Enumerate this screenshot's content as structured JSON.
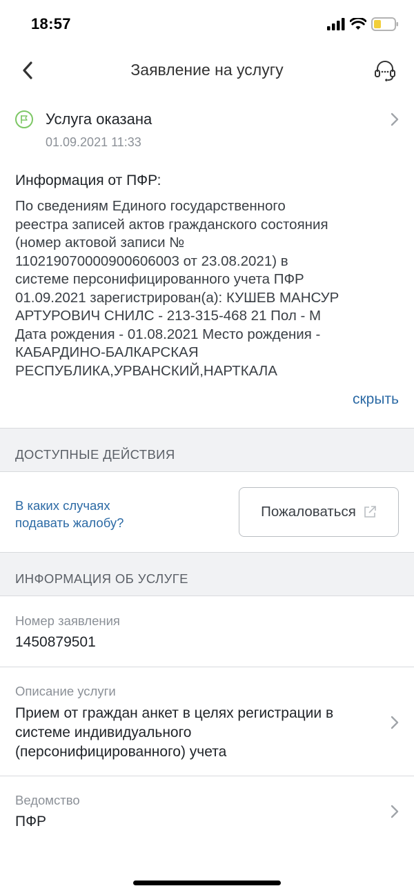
{
  "status_bar": {
    "time": "18:57",
    "icons": [
      "signal-icon",
      "wifi-icon",
      "battery-icon"
    ]
  },
  "nav": {
    "title": "Заявление на услугу",
    "back_icon": "chevron-left-icon",
    "support_icon": "headset-icon"
  },
  "application_status": {
    "title": "Услуга оказана",
    "date": "01.09.2021 11:33",
    "icon": "flag-icon",
    "status_color": "#7dc765"
  },
  "pfr_info": {
    "heading": "Информация от ПФР:",
    "lines": [
      "По сведениям Единого государственного",
      "реестра записей актов гражданского состояния",
      "(номер актовой записи №",
      "110219070000900606003 от 23.08.2021) в",
      "системе персонифицированного учета ПФР",
      "01.09.2021 зарегистрирован(а): КУШЕВ МАНСУР",
      "АРТУРОВИЧ СНИЛС - 213-315-468 21 Пол - М",
      "Дата рождения - 01.08.2021 Место рождения -",
      "КАБАРДИНО-БАЛКАРСКАЯ",
      "РЕСПУБЛИКА,УРВАНСКИЙ,НАРТКАЛА"
    ],
    "hide_link": "скрыть"
  },
  "actions_section": {
    "header": "ДОСТУПНЫЕ ДЕЙСТВИЯ",
    "complaint_help_line1": "В каких случаях",
    "complaint_help_line2": "подавать жалобу?",
    "complaint_button": "Пожаловаться",
    "complaint_icon": "external-link-icon"
  },
  "service_info_section": {
    "header": "ИНФОРМАЦИЯ ОБ УСЛУГЕ",
    "fields": [
      {
        "label": "Номер заявления",
        "value_lines": [
          "1450879501"
        ]
      },
      {
        "label": "Описание услуги",
        "value_lines": [
          "Прием от граждан анкет в целях регистрации в",
          "системе индивидуального",
          "(персонифицированного) учета"
        ]
      },
      {
        "label": "Ведомство",
        "value_lines": [
          "ПФР"
        ]
      }
    ]
  },
  "colors": {
    "link": "#2c6aa5",
    "section_bg": "#f1f2f4",
    "success": "#7dc765"
  }
}
